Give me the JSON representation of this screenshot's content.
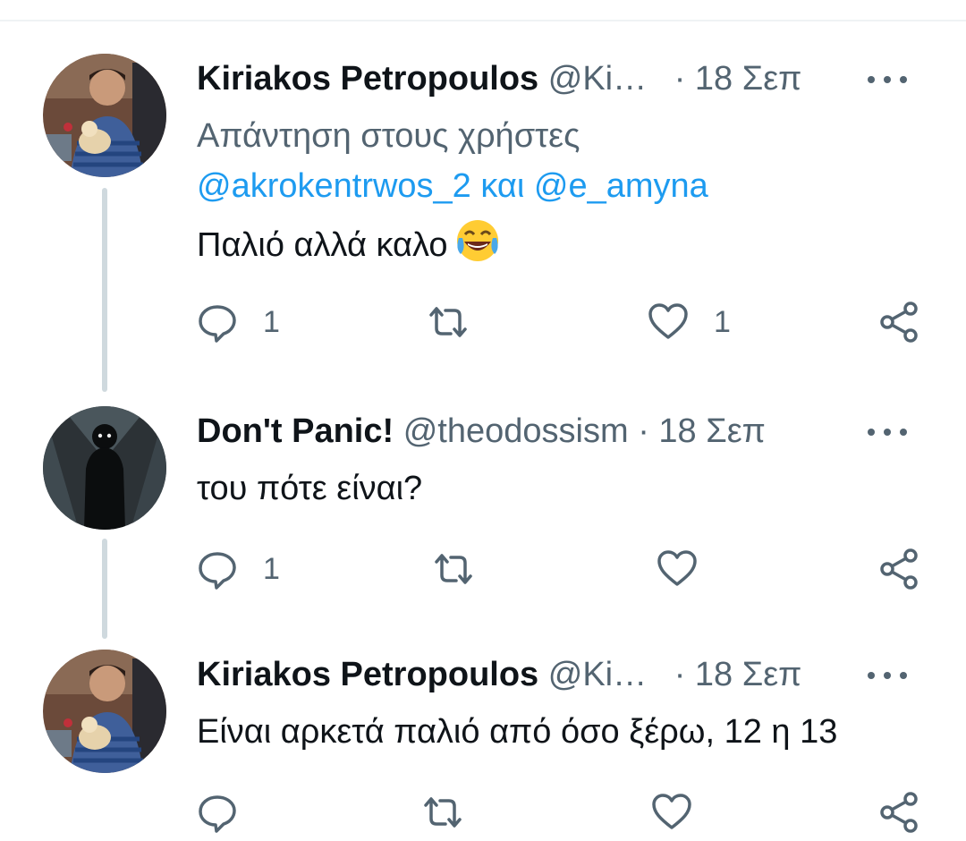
{
  "tweets": [
    {
      "author_name": "Kiriakos Petropoulos",
      "handle": "@Ki…",
      "separator": "·",
      "date": "18 Σεπ",
      "reply_prefix": "Απάντηση στους χρήστες",
      "mention_1": "@akrokentrwos_2",
      "reply_connector": "και",
      "mention_2": "@e_amyna",
      "text": "Παλιό αλλά καλο",
      "emoji": "face-with-tears-of-joy",
      "reply_count": "1",
      "retweet_count": "",
      "like_count": "1"
    },
    {
      "author_name": "Don't Panic!",
      "handle": "@theodossism",
      "separator": "·",
      "date": "18 Σεπ",
      "text": "του πότε είναι?",
      "reply_count": "1",
      "retweet_count": "",
      "like_count": ""
    },
    {
      "author_name": "Kiriakos Petropoulos",
      "handle": "@Ki…",
      "separator": "·",
      "date": "18 Σεπ",
      "text": "Είναι αρκετά παλιό από όσο ξέρω, 12 η 13",
      "reply_count": "",
      "retweet_count": "",
      "like_count": ""
    }
  ],
  "colors": {
    "text": "#0f1419",
    "secondary": "#536471",
    "link": "#1d9bf0",
    "thread_line": "#cfd9de"
  },
  "icons": [
    "reply-icon",
    "retweet-icon",
    "like-icon",
    "share-icon",
    "more-icon"
  ]
}
